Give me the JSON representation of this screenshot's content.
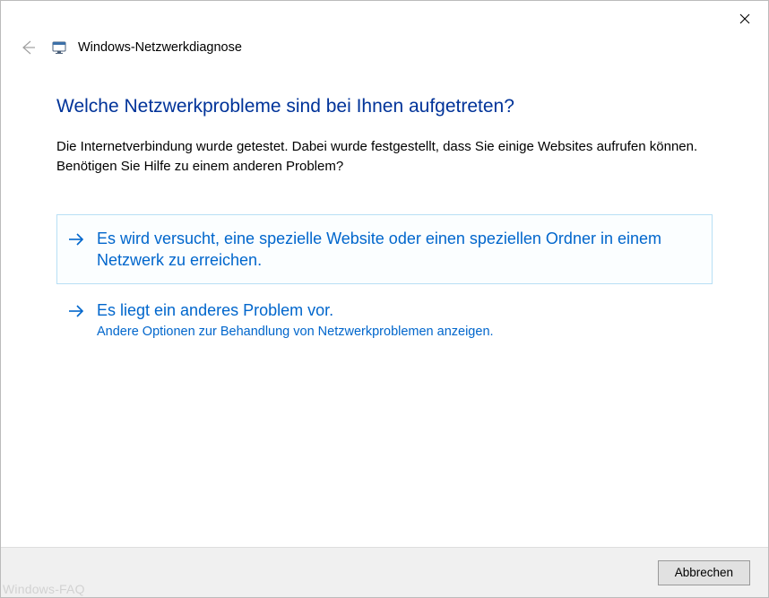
{
  "window": {
    "title": "Windows-Netzwerkdiagnose"
  },
  "content": {
    "heading": "Welche Netzwerkprobleme sind bei Ihnen aufgetreten?",
    "description": "Die Internetverbindung wurde getestet. Dabei wurde festgestellt, dass Sie einige Websites aufrufen können. Benötigen Sie Hilfe zu einem anderen Problem?"
  },
  "options": [
    {
      "title": "Es wird versucht, eine spezielle Website oder einen speziellen Ordner in einem Netzwerk zu erreichen.",
      "subtitle": ""
    },
    {
      "title": "Es liegt ein anderes Problem vor.",
      "subtitle": "Andere Optionen zur Behandlung von Netzwerkproblemen anzeigen."
    }
  ],
  "footer": {
    "cancel_label": "Abbrechen"
  },
  "watermark": "Windows-FAQ",
  "colors": {
    "link_blue": "#0066cc",
    "heading_blue": "#003399"
  }
}
